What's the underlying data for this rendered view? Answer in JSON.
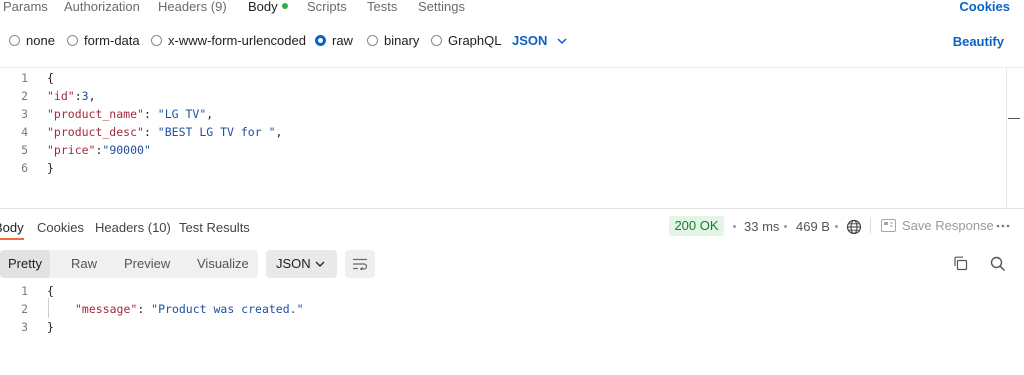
{
  "request_tabs": {
    "params": "Params",
    "authorization": "Authorization",
    "headers": "Headers",
    "headers_count": "(9)",
    "body": "Body",
    "scripts": "Scripts",
    "tests": "Tests",
    "settings": "Settings",
    "cookies": "Cookies"
  },
  "body_types": {
    "none": "none",
    "form_data": "form-data",
    "urlencoded": "x-www-form-urlencoded",
    "raw": "raw",
    "binary": "binary",
    "graphql": "GraphQL",
    "selected": "raw",
    "format": "JSON",
    "beautify": "Beautify"
  },
  "request_body": {
    "lines": [
      {
        "n": "1",
        "text": "{"
      },
      {
        "n": "2",
        "key": "\"id\"",
        "sep": ":",
        "val": "3",
        "tail": ","
      },
      {
        "n": "3",
        "key": "\"product_name\"",
        "sep": ": ",
        "val": "\"LG TV\"",
        "tail": ","
      },
      {
        "n": "4",
        "key": "\"product_desc\"",
        "sep": ": ",
        "val": "\"BEST LG TV for \"",
        "tail": ","
      },
      {
        "n": "5",
        "key": "\"price\"",
        "sep": ":",
        "val": "\"90000\"",
        "tail": ""
      },
      {
        "n": "6",
        "text": "}"
      }
    ]
  },
  "response_tabs": {
    "body": "Body",
    "cookies": "Cookies",
    "headers": "Headers (10)",
    "test_results": "Test Results"
  },
  "response_meta": {
    "status": "200 OK",
    "time": "33 ms",
    "size": "469 B",
    "save": "Save Response",
    "status_color": "#1c7a34"
  },
  "response_view": {
    "pretty": "Pretty",
    "raw": "Raw",
    "preview": "Preview",
    "visualize": "Visualize",
    "format": "JSON"
  },
  "response_body": {
    "lines": [
      {
        "n": "1",
        "text": "{"
      },
      {
        "n": "2",
        "key": "\"message\"",
        "sep": ": ",
        "val": "\"Product was created.\""
      },
      {
        "n": "3",
        "text": "}"
      }
    ]
  },
  "colors": {
    "accent": "#0b62c7",
    "active_tab_underline": "#f26b3a",
    "body_dot": "#2bb04a"
  },
  "icons": [
    "chevron-down-icon",
    "globe-icon",
    "save-icon",
    "more-icon",
    "wrap-icon",
    "copy-icon",
    "search-icon"
  ]
}
